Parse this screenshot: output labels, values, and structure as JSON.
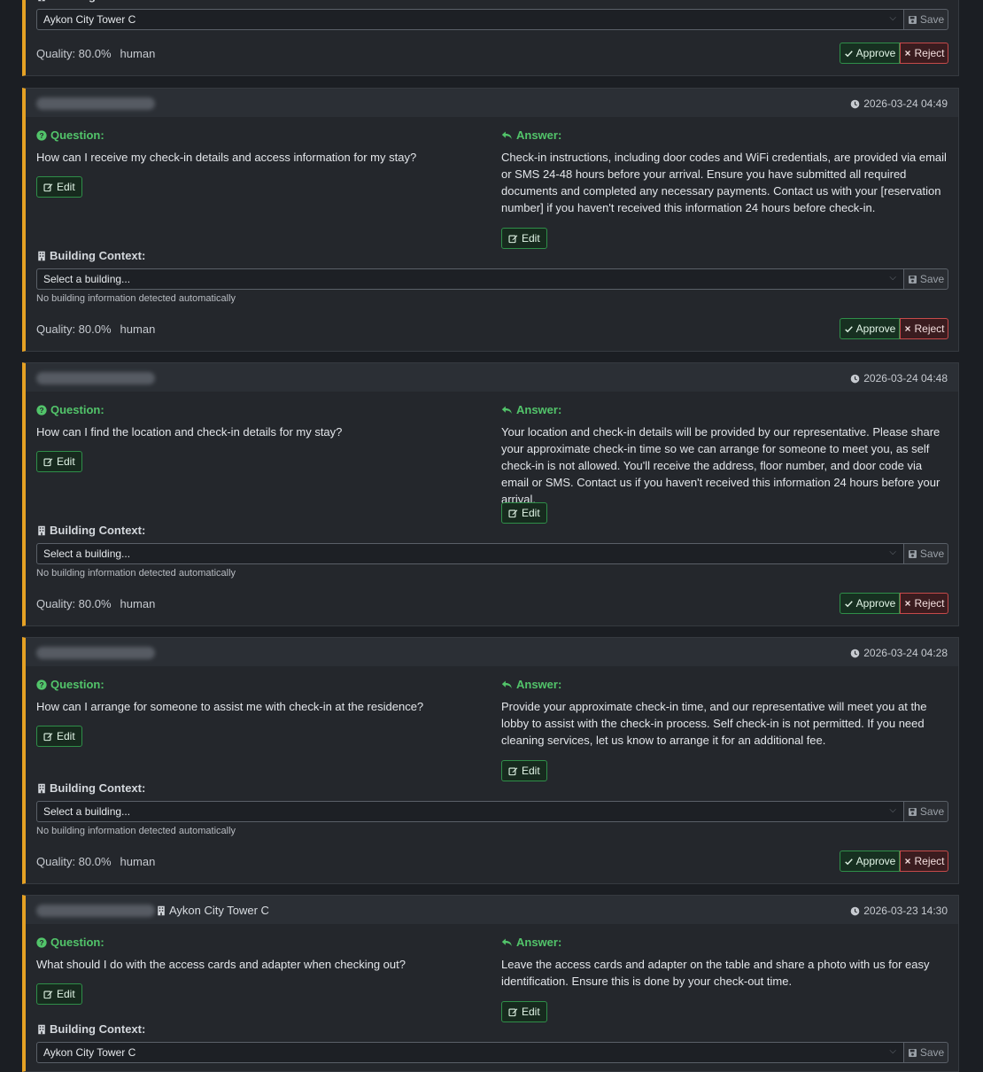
{
  "labels": {
    "question": "Question:",
    "answer": "Answer:",
    "edit": "Edit",
    "building_context": "Building Context:",
    "save": "Save",
    "approve": "Approve",
    "reject": "Reject",
    "no_building_hint": "No building information detected automatically",
    "select_placeholder": "Select a building..."
  },
  "colors": {
    "accent_border": "#e5a124",
    "question_green": "#52c46a",
    "approve_green": "#2f8f49",
    "reject_red": "#c64a4a"
  },
  "top_partial": {
    "building_selected": "Aykon City Tower C",
    "quality": "Quality: 80.0%",
    "source": "human"
  },
  "items": [
    {
      "timestamp": "2026-03-24 04:49",
      "question": "How can I receive my check-in details and access information for my stay?",
      "answer": "Check-in instructions, including door codes and WiFi credentials, are provided via email or SMS 24-48 hours before your arrival. Ensure you have submitted all required documents and completed any necessary payments. Contact us with your [reservation number] if you haven't received this information 24 hours before check-in.",
      "building_selected": "Select a building...",
      "quality": "Quality: 80.0%",
      "source": "human"
    },
    {
      "timestamp": "2026-03-24 04:48",
      "question": "How can I find the location and check-in details for my stay?",
      "answer": "Your location and check-in details will be provided by our representative. Please share your approximate check-in time so we can arrange for someone to meet you, as self check-in is not allowed. You'll receive the address, floor number, and door code via email or SMS. Contact us if you haven't received this information 24 hours before your arrival.",
      "building_selected": "Select a building...",
      "quality": "Quality: 80.0%",
      "source": "human"
    },
    {
      "timestamp": "2026-03-24 04:28",
      "question": "How can I arrange for someone to assist me with check-in at the residence?",
      "answer": "Provide your approximate check-in time, and our representative will meet you at the lobby to assist with the check-in process. Self check-in is not permitted. If you need cleaning services, let us know to arrange it for an additional fee.",
      "building_selected": "Select a building...",
      "quality": "Quality: 80.0%",
      "source": "human"
    },
    {
      "timestamp": "2026-03-23 14:30",
      "header_building": "Aykon City Tower C",
      "question": "What should I do with the access cards and adapter when checking out?",
      "answer": "Leave the access cards and adapter on the table and share a photo with us for easy identification. Ensure this is done by your check-out time.",
      "building_selected": "Aykon City Tower C"
    }
  ]
}
